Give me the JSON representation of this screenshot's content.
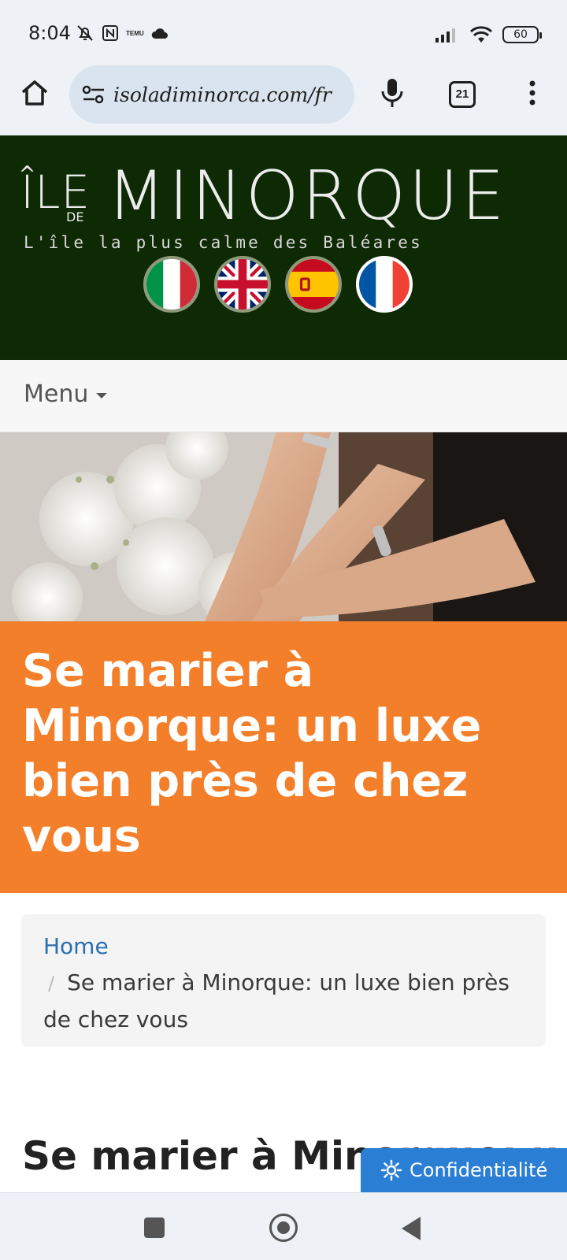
{
  "status_bar": {
    "time": "8:04",
    "temu_label": "TEMU",
    "battery_level": "60"
  },
  "browser": {
    "url": "isoladiminorca.com/fr",
    "tab_count": "21"
  },
  "site": {
    "logo": {
      "ile": "ÎLE",
      "de": "DE",
      "main": "MINORQUE"
    },
    "tagline": "L'île la plus calme des Baléares",
    "languages": [
      {
        "name": "italian",
        "active": false
      },
      {
        "name": "english",
        "active": false
      },
      {
        "name": "spanish",
        "active": false
      },
      {
        "name": "french",
        "active": true
      }
    ],
    "menu_label": "Menu"
  },
  "page": {
    "title": "Se marier à Minorque: un luxe bien près de chez vous",
    "breadcrumb": {
      "home": "Home",
      "separator": "/",
      "current": "Se marier à Minorque: un luxe bien près de chez vous"
    },
    "article_heading": "Se marier à Minorque: un luxe bien près de chez vous"
  },
  "privacy_button": "Confidentialité",
  "colors": {
    "header_bg": "#0e2a04",
    "title_band": "#f47f2a",
    "link": "#2a6fb0",
    "privacy_bg": "#2a7ed4"
  }
}
